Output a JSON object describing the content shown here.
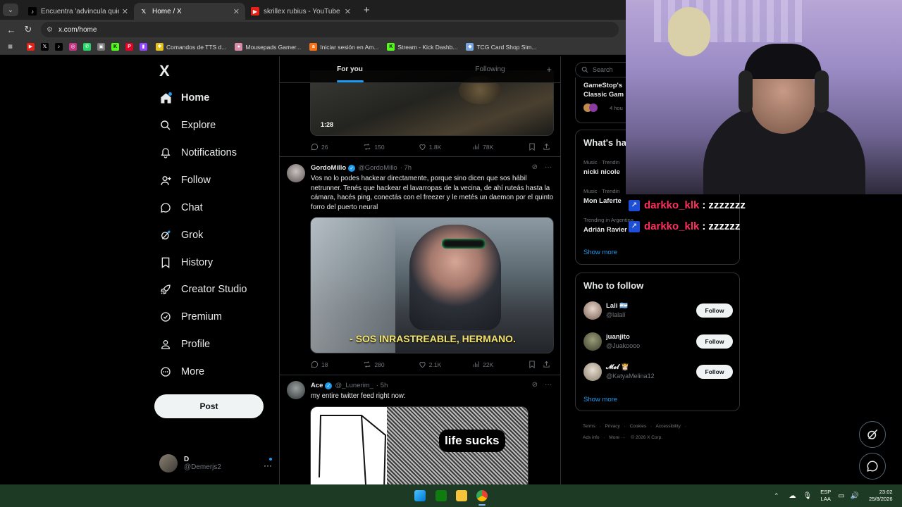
{
  "browser": {
    "tabs": [
      {
        "title": "Encuentra 'advincula quiero ke",
        "icon": "tiktok-icon",
        "active": false
      },
      {
        "title": "Home / X",
        "icon": "x-icon",
        "active": true
      },
      {
        "title": "skrillex rubius - YouTube",
        "icon": "youtube-icon",
        "active": false
      }
    ],
    "new_tab": "+",
    "url": "x.com/home",
    "bookmarks": [
      {
        "label": "Comandos de TTS d...",
        "color": "#e5c21a"
      },
      {
        "label": "Mousepads Gamer...",
        "color": "#d88aa8"
      },
      {
        "label": "Iniciar sesión en Am...",
        "color": "#f97316"
      },
      {
        "label": "Stream - Kick Dashb...",
        "color": "#53fc18"
      },
      {
        "label": "TCG Card Shop Sim...",
        "color": "#7aa6e0"
      }
    ]
  },
  "x": {
    "logo": "X",
    "nav": [
      {
        "label": "Home",
        "icon": "home-icon",
        "active": true
      },
      {
        "label": "Explore",
        "icon": "search-icon"
      },
      {
        "label": "Notifications",
        "icon": "bell-icon"
      },
      {
        "label": "Follow",
        "icon": "person-add-icon"
      },
      {
        "label": "Chat",
        "icon": "chat-icon"
      },
      {
        "label": "Grok",
        "icon": "grok-icon"
      },
      {
        "label": "History",
        "icon": "bookmark-icon"
      },
      {
        "label": "Creator Studio",
        "icon": "rocket-icon"
      },
      {
        "label": "Premium",
        "icon": "verified-icon"
      },
      {
        "label": "Profile",
        "icon": "person-icon"
      },
      {
        "label": "More",
        "icon": "more-circle-icon"
      }
    ],
    "post_label": "Post",
    "account": {
      "name": "D",
      "handle": "@Demerjs2"
    },
    "feed_tabs": {
      "for_you": "For you",
      "following": "Following",
      "add": "+"
    },
    "tweets": [
      {
        "video_time": "1:28",
        "stats": {
          "replies": "26",
          "reposts": "150",
          "likes": "1.8K",
          "views": "78K"
        }
      },
      {
        "name": "GordoMillo",
        "handle": "@GordoMillo",
        "time": "· 7h",
        "text": "Vos no lo podes hackear directamente, porque sino dicen que sos hábil netrunner. Tenés que hackear el lavarropas de la vecina, de ahí ruteás hasta la cámara, hacés ping, conectás con el freezer y le metés un daemon por el quinto forro del puerto neural",
        "caption": "- SOS INRASTREABLE, HERMANO.",
        "stats": {
          "replies": "18",
          "reposts": "280",
          "likes": "2.1K",
          "views": "22K"
        }
      },
      {
        "name": "Ace",
        "handle": "@_Lunerim_",
        "time": "· 5h",
        "text": "my entire twitter feed right now:",
        "caption": "life sucks"
      }
    ],
    "right": {
      "search_placeholder": "Search",
      "top_card": {
        "title_1": "GameStop's",
        "title_2": "Classic Gam",
        "time": "4 hou"
      },
      "happening_title": "What's ha",
      "trends": [
        {
          "category": "Music · Trendin",
          "name": "nicki nicole"
        },
        {
          "category": "Music · Trendin",
          "name": "Mon Laferte"
        },
        {
          "category": "Trending in Argentina",
          "name": "Adrián Ravier"
        }
      ],
      "trends_show_more": "Show more",
      "who_title": "Who to follow",
      "who": [
        {
          "name": "Lali 🇦🇷",
          "handle": "@lalalí"
        },
        {
          "name": "juanjito",
          "handle": "@Juakoooo"
        },
        {
          "name": "𝓜𝓮𝓵 👸🏻",
          "handle": "@KatyaMelina12"
        }
      ],
      "follow_label": "Follow",
      "who_show_more": "Show more",
      "footer": [
        "Terms",
        "·",
        "Privacy",
        "·",
        "Cookies",
        "·",
        "Accessibility",
        "·",
        "Ads info",
        "·",
        "More ···",
        "© 2026 X Corp."
      ]
    }
  },
  "stream": {
    "chat": [
      {
        "user": "darkko_klk",
        "sep": ":",
        "msg": "zzzzzzz"
      },
      {
        "user": "darkko_klk",
        "sep": ":",
        "msg": "zzzzzz"
      }
    ]
  },
  "taskbar": {
    "lang_1": "ESP",
    "lang_2": "LAA",
    "time": "23:02",
    "date": "25/8/2026"
  },
  "colors": {
    "accent": "#1d9bf0",
    "background": "#000000",
    "chat_user": "#ff2e5d",
    "taskbar": "#1c3a24"
  }
}
